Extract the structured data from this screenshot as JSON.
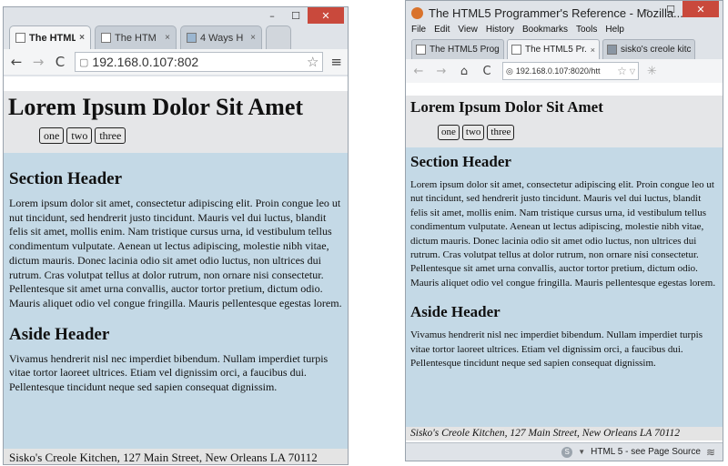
{
  "left_window": {
    "controls": {
      "minimize": "–",
      "maximize": "☐",
      "close": "✕"
    },
    "tabs": [
      {
        "label": "The HTML",
        "active": true
      },
      {
        "label": "The HTM",
        "active": false
      },
      {
        "label": "4 Ways H",
        "active": false
      }
    ],
    "tab_close": "×",
    "toolbar": {
      "back": "←",
      "forward": "→",
      "reload": "C",
      "url": "192.168.0.107:802",
      "star": "☆",
      "menu": "≡"
    },
    "page": {
      "title": "Lorem Ipsum Dolor Sit Amet",
      "nav_buttons": [
        "one",
        "two",
        "three"
      ],
      "section_header": "Section Header",
      "section_text": "Lorem ipsum dolor sit amet, consectetur adipiscing elit. Proin congue leo ut nut tincidunt, sed hendrerit justo tincidunt. Mauris vel dui luctus, blandit felis sit amet, mollis enim. Nam tristique cursus urna, id vestibulum tellus condimentum vulputate. Aenean ut lectus adipiscing, molestie nibh vitae, dictum mauris. Donec lacinia odio sit amet odio luctus, non ultrices dui rutrum. Cras volutpat tellus at dolor rutrum, non ornare nisi consectetur. Pellentesque sit amet urna convallis, auctor tortor pretium, dictum odio. Mauris aliquet odio vel congue fringilla. Mauris pellentesque egestas lorem.",
      "aside_header": "Aside Header",
      "aside_text": "Vivamus hendrerit nisl nec imperdiet bibendum. Nullam imperdiet turpis vitae tortor laoreet ultrices. Etiam vel dignissim orci, a faucibus dui. Pellentesque tincidunt neque sed sapien consequat dignissim.",
      "footer": "Sisko's Creole Kitchen, 127 Main Street, New Orleans LA 70112"
    }
  },
  "right_window": {
    "title": "The HTML5 Programmer's Reference - Mozilla...",
    "controls": {
      "minimize": "–",
      "maximize": "☐",
      "close": "✕"
    },
    "menu": [
      "File",
      "Edit",
      "View",
      "History",
      "Bookmarks",
      "Tools",
      "Help"
    ],
    "tabs": [
      {
        "label": "The HTML5 Progr...",
        "active": false
      },
      {
        "label": "The HTML5 Pr...",
        "active": true
      },
      {
        "label": "sisko's creole kitc...",
        "active": false
      }
    ],
    "tab_close": "×",
    "toolbar": {
      "back": "←",
      "forward": "→",
      "home": "⌂",
      "reload": "C",
      "url": "192.168.0.107:8020/htt",
      "star": "☆",
      "dropdown": "▽",
      "spinner": "✳"
    },
    "page": {
      "title": "Lorem Ipsum Dolor Sit Amet",
      "nav_buttons": [
        "one",
        "two",
        "three"
      ],
      "section_header": "Section Header",
      "section_text": "Lorem ipsum dolor sit amet, consectetur adipiscing elit. Proin congue leo ut nut tincidunt, sed hendrerit justo tincidunt. Mauris vel dui luctus, blandit felis sit amet, mollis enim. Nam tristique cursus urna, id vestibulum tellus condimentum vulputate. Aenean ut lectus adipiscing, molestie nibh vitae, dictum mauris. Donec lacinia odio sit amet odio luctus, non ultrices dui rutrum. Cras volutpat tellus at dolor rutrum, non ornare nisi consectetur. Pellentesque sit amet urna convallis, auctor tortor pretium, dictum odio. Mauris aliquet odio vel congue fringilla. Mauris pellentesque egestas lorem.",
      "aside_header": "Aside Header",
      "aside_text": "Vivamus hendrerit nisl nec imperdiet bibendum. Nullam imperdiet turpis vitae tortor laoreet ultrices. Etiam vel dignissim orci, a faucibus dui. Pellentesque tincidunt neque sed sapien consequat dignissim.",
      "footer": "Sisko's Creole Kitchen, 127 Main Street, New Orleans LA 70112"
    },
    "status": {
      "addon_icon": "S",
      "dropdown": "▼",
      "text": "HTML 5 - see Page Source",
      "layers": "≋"
    }
  },
  "colors": {
    "content_bg": "#c4d9e6",
    "header_bg": "#e5e6e8",
    "close_button": "#c9493c"
  }
}
